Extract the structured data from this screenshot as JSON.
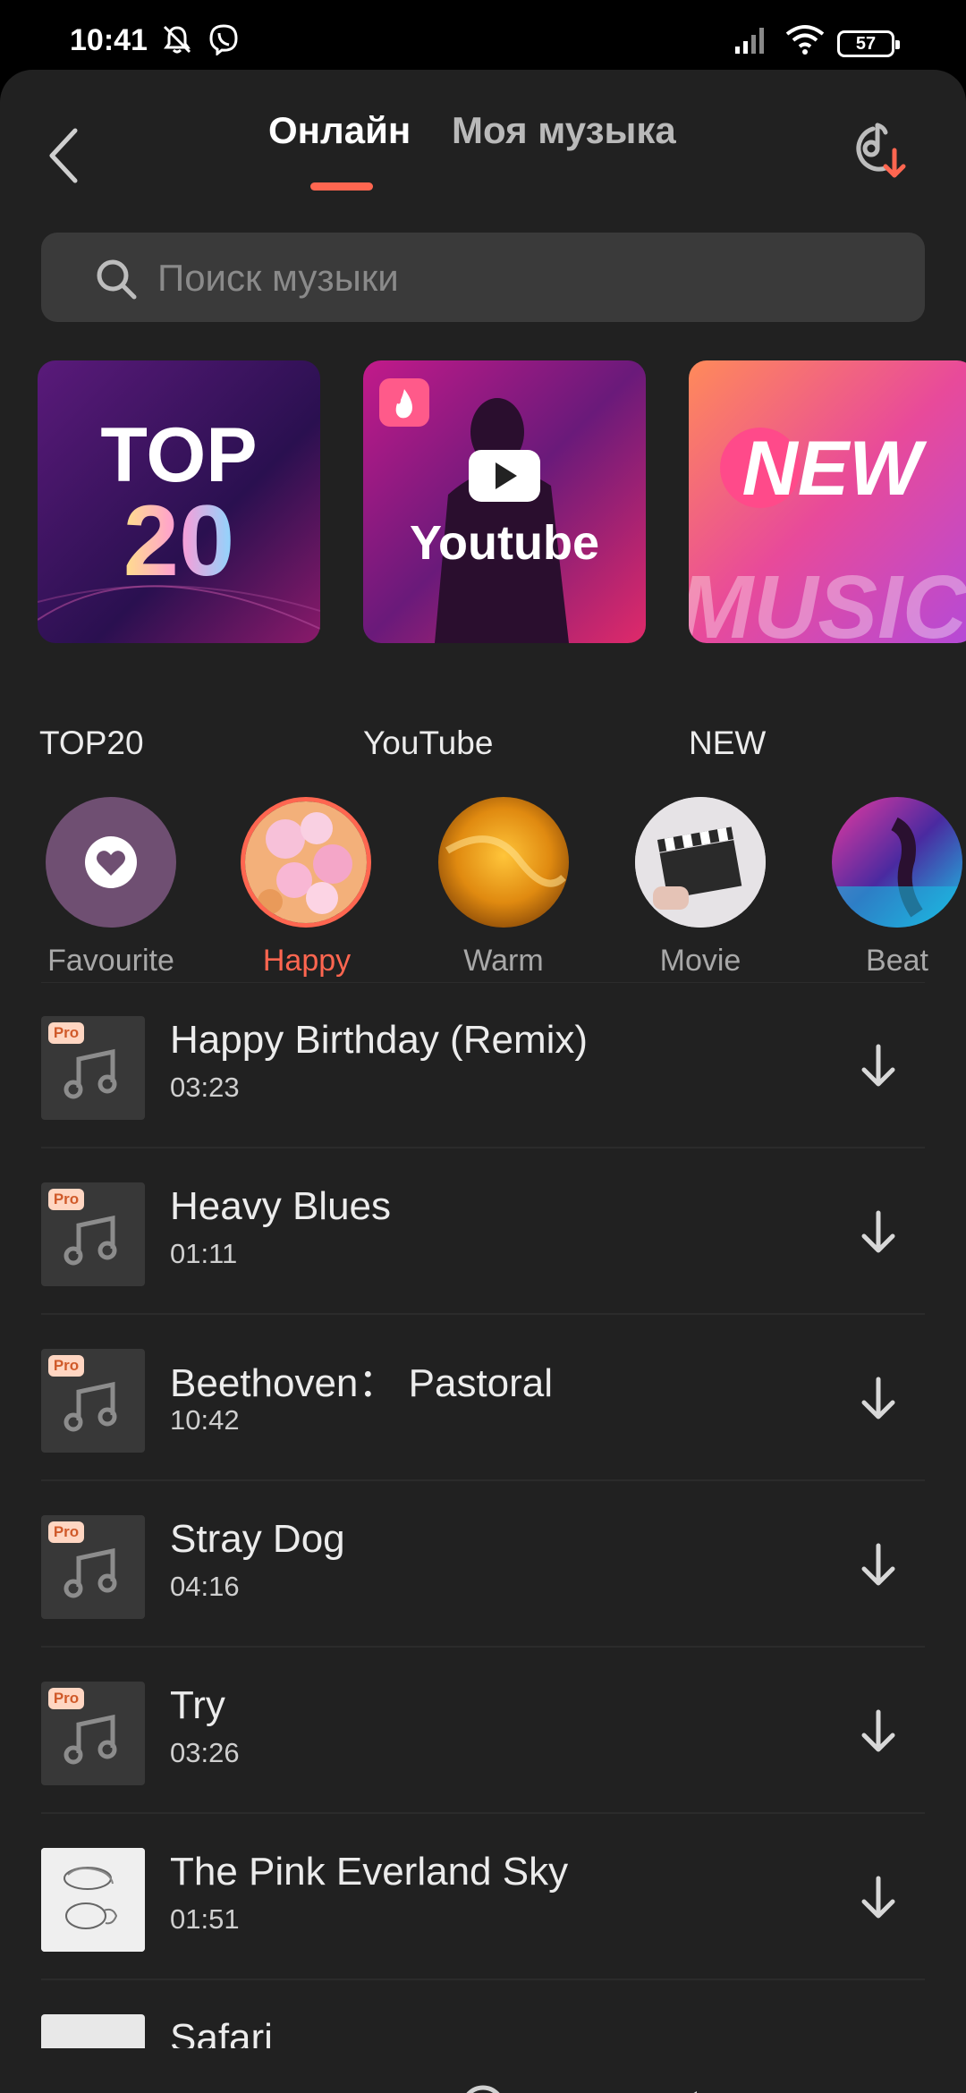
{
  "status_bar": {
    "time": "10:41",
    "battery": "57"
  },
  "header": {
    "tabs": [
      {
        "label": "Онлайн",
        "active": true
      },
      {
        "label": "Моя музыка",
        "active": false
      }
    ]
  },
  "search": {
    "placeholder": "Поиск музыки",
    "value": ""
  },
  "playlists": [
    {
      "label": "TOP20",
      "art_text_line1": "TOP",
      "art_text_line2": "20"
    },
    {
      "label": "YouTube",
      "art_text": "Youtube"
    },
    {
      "label": "NEW",
      "art_text": "NEW",
      "art_text2": "MUSIC"
    }
  ],
  "moods": [
    {
      "label": "Favourite",
      "selected": false
    },
    {
      "label": "Happy",
      "selected": true
    },
    {
      "label": "Warm",
      "selected": false
    },
    {
      "label": "Movie",
      "selected": false
    },
    {
      "label": "Beat",
      "selected": false
    }
  ],
  "tracks": [
    {
      "title": "Happy Birthday (Remix)",
      "duration": "03:23",
      "pro": true,
      "pro_label": "Pro"
    },
    {
      "title": "Heavy Blues",
      "duration": "01:11",
      "pro": true,
      "pro_label": "Pro"
    },
    {
      "title": "Beethoven： Pastoral",
      "duration": "10:42",
      "pro": true,
      "pro_label": "Pro"
    },
    {
      "title": "Stray Dog",
      "duration": "04:16",
      "pro": true,
      "pro_label": "Pro"
    },
    {
      "title": "Try",
      "duration": "03:26",
      "pro": true,
      "pro_label": "Pro"
    },
    {
      "title": "The Pink Everland Sky",
      "duration": "01:51",
      "pro": false
    },
    {
      "title": "Safari",
      "duration": "",
      "pro": false
    }
  ],
  "colors": {
    "accent": "#ff6650",
    "background": "#212121",
    "search_bg": "#3a3a3a"
  },
  "icons": [
    "back-arrow-icon",
    "music-download-icon",
    "search-icon",
    "music-note-icon",
    "download-arrow-icon",
    "heart-icon",
    "flame-icon",
    "play-icon"
  ]
}
